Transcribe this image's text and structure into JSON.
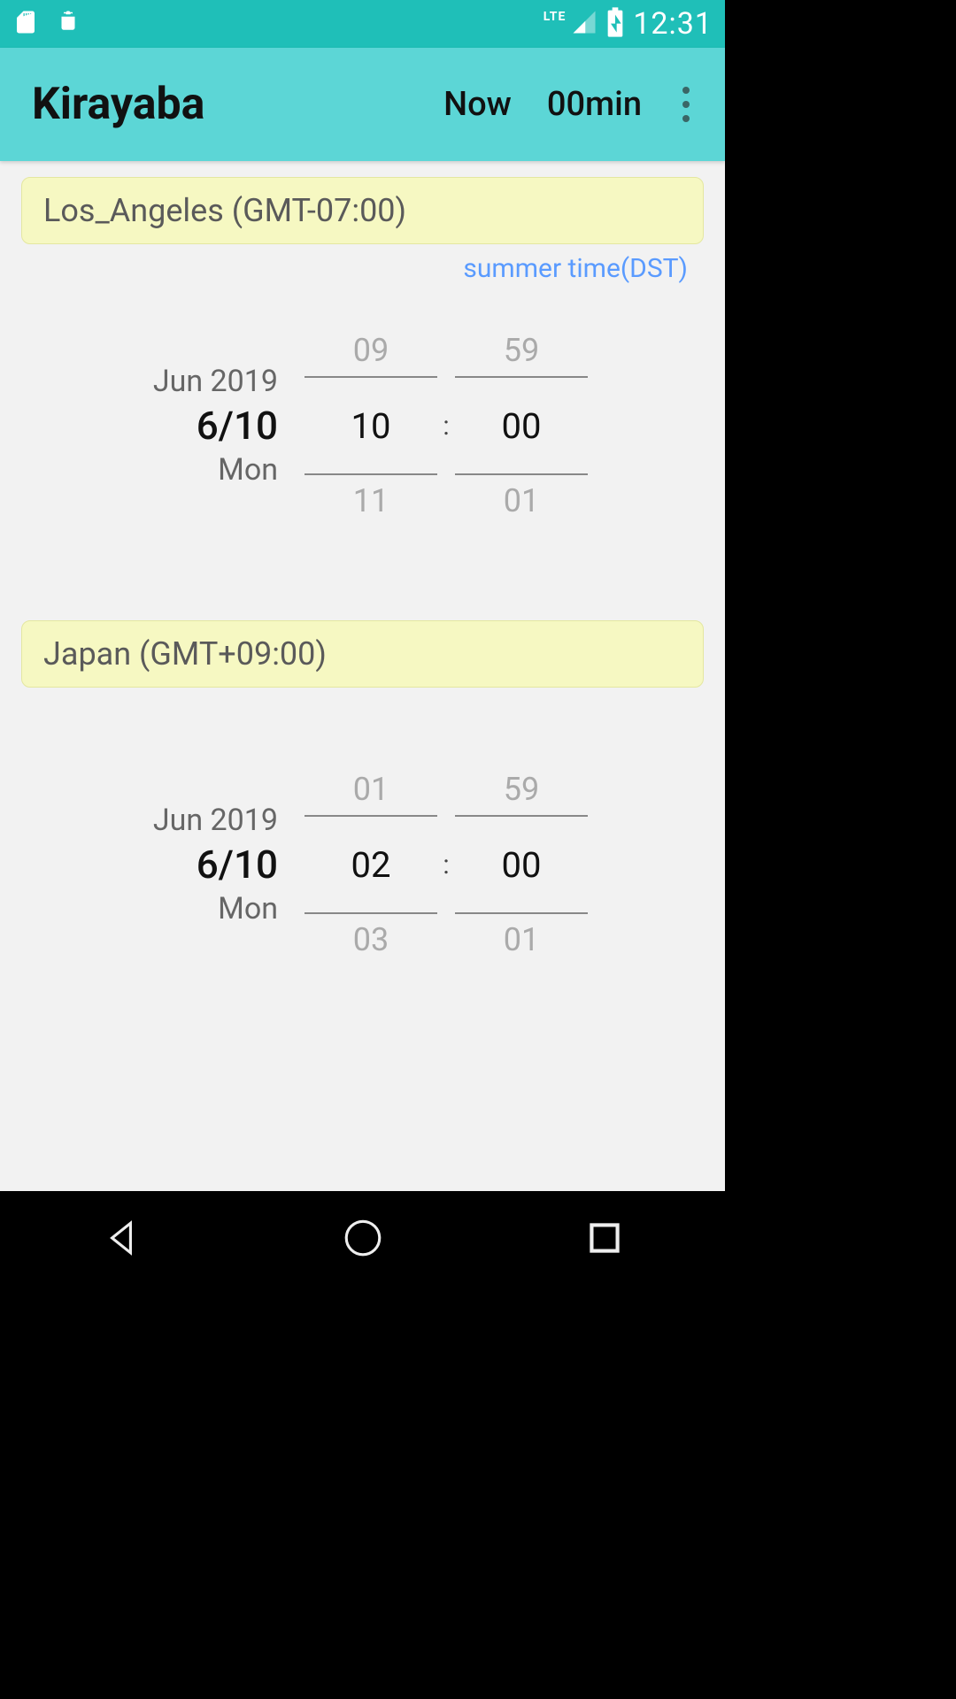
{
  "status_bar": {
    "lte": "LTE",
    "clock": "12:31"
  },
  "app_bar": {
    "title": "Kirayaba",
    "now": "Now",
    "interval": "00min"
  },
  "timezones": [
    {
      "label": "Los_Angeles (GMT-07:00)",
      "dst": "summer time(DST)",
      "month_year": "Jun 2019",
      "date": "6/10",
      "dow": "Mon",
      "hour_prev": "09",
      "hour": "10",
      "hour_next": "11",
      "min_prev": "59",
      "min": "00",
      "min_next": "01"
    },
    {
      "label": "Japan (GMT+09:00)",
      "dst": "",
      "month_year": "Jun 2019",
      "date": "6/10",
      "dow": "Mon",
      "hour_prev": "01",
      "hour": "02",
      "hour_next": "03",
      "min_prev": "59",
      "min": "00",
      "min_next": "01"
    }
  ],
  "colon": ":"
}
